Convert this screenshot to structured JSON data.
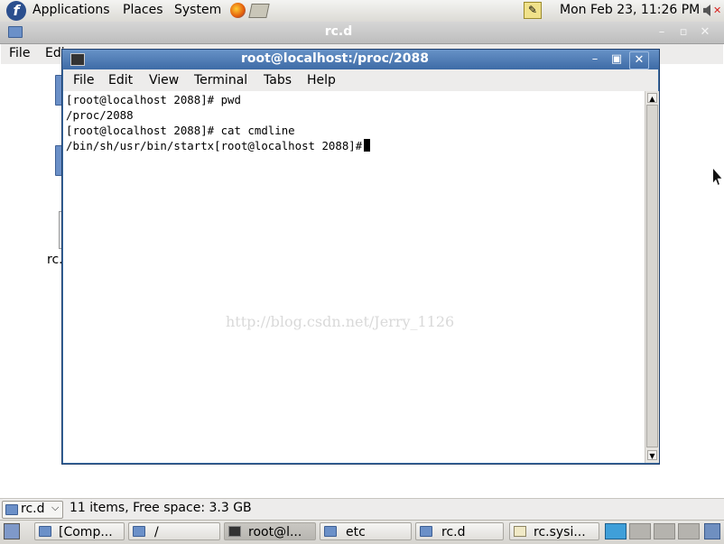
{
  "top_panel": {
    "menus": [
      "Applications",
      "Places",
      "System"
    ],
    "clock": "Mon Feb 23, 11:26 PM"
  },
  "file_manager": {
    "title": "rc.d",
    "menus": [
      "File",
      "Edi"
    ],
    "desktop_item_label": "rc.",
    "location_value": "rc.d",
    "status_text": "11 items, Free space: 3.3 GB"
  },
  "terminal": {
    "title": "root@localhost:/proc/2088",
    "menus": [
      "File",
      "Edit",
      "View",
      "Terminal",
      "Tabs",
      "Help"
    ],
    "lines": [
      "[root@localhost 2088]# pwd",
      "/proc/2088",
      "[root@localhost 2088]# cat cmdline",
      "/bin/sh/usr/bin/startx[root@localhost 2088]#"
    ],
    "watermark": "http://blog.csdn.net/Jerry_1126"
  },
  "taskbar": {
    "items": [
      "[Comp...",
      "/",
      "root@l...",
      "etc",
      "rc.d",
      "rc.sysi..."
    ]
  },
  "colors": {
    "terminal_title": "#4a79b4",
    "panel": "#dcdad5",
    "active_workspace": "#3f9fd9"
  }
}
